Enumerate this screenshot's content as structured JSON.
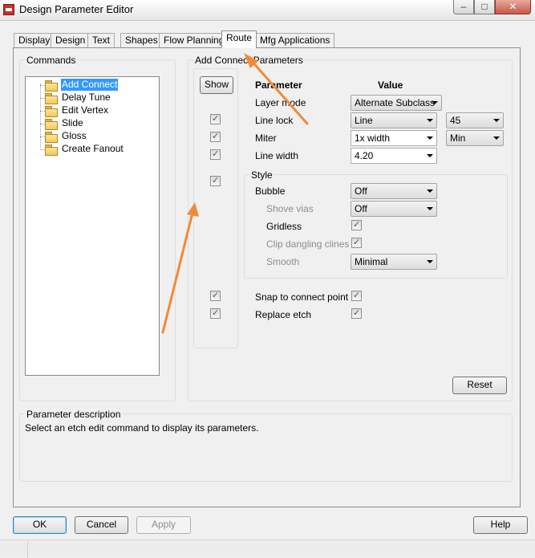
{
  "window": {
    "title": "Design Parameter Editor"
  },
  "tabs": [
    {
      "label": "Display"
    },
    {
      "label": "Design"
    },
    {
      "label": "Text"
    },
    {
      "label": "Shapes"
    },
    {
      "label": "Flow Planning"
    },
    {
      "label": "Route"
    },
    {
      "label": "Mfg Applications"
    }
  ],
  "commands": {
    "title": "Commands",
    "items": [
      "Add Connect",
      "Delay Tune",
      "Edit Vertex",
      "Slide",
      "Gloss",
      "Create Fanout"
    ],
    "selected": "Add Connect"
  },
  "params": {
    "title": "Add Connect Parameters",
    "show_label": "Show",
    "col_parameter": "Parameter",
    "col_value": "Value",
    "layer_mode": {
      "label": "Layer mode",
      "value": "Alternate Subclass"
    },
    "line_lock": {
      "label": "Line lock",
      "value": "Line",
      "angle": "45"
    },
    "miter": {
      "label": "Miter",
      "value": "1x width",
      "size": "Min"
    },
    "line_width": {
      "label": "Line width",
      "value": "4.20"
    },
    "style": {
      "title": "Style",
      "bubble": {
        "label": "Bubble",
        "value": "Off"
      },
      "shove_vias": {
        "label": "Shove vias",
        "value": "Off"
      },
      "gridless": {
        "label": "Gridless"
      },
      "clip_dangling": {
        "label": "Clip dangling clines"
      },
      "smooth": {
        "label": "Smooth",
        "value": "Minimal"
      }
    },
    "snap": {
      "label": "Snap to connect point"
    },
    "replace_etch": {
      "label": "Replace etch"
    },
    "reset_label": "Reset"
  },
  "description": {
    "title": "Parameter description",
    "text": "Select an etch edit command to display its parameters."
  },
  "buttons": {
    "ok": "OK",
    "cancel": "Cancel",
    "apply": "Apply",
    "help": "Help"
  },
  "colors": {
    "selection": "#3399ff",
    "annotation_arrow": "#f08a3a"
  },
  "icons": {
    "minimize": "–",
    "maximize": "□",
    "close": "✕"
  }
}
